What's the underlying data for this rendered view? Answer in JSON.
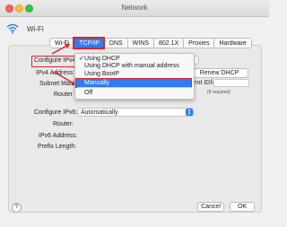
{
  "window": {
    "title": "Network"
  },
  "header": {
    "interface_label": "Wi-Fi"
  },
  "tabs": [
    {
      "label": "Wi-Fi"
    },
    {
      "label": "TCP/IP"
    },
    {
      "label": "DNS"
    },
    {
      "label": "WINS"
    },
    {
      "label": "802.1X"
    },
    {
      "label": "Proxies"
    },
    {
      "label": "Hardware"
    }
  ],
  "active_tab": "TCP/IP",
  "ipv4": {
    "configure_label": "Configure IPv4",
    "address_label": "IPv4 Address",
    "subnet_label": "Subnet Mask",
    "router_label": "Router",
    "renew_button": "Renew DHCP Lease",
    "client_id_label": "ient ID:",
    "if_required": "(If required)"
  },
  "ipv4_menu": {
    "items": [
      {
        "label": "Using DHCP",
        "checked": true
      },
      {
        "label": "Using DHCP with manual address",
        "checked": false
      },
      {
        "label": "Using BootP",
        "checked": false
      },
      {
        "label": "Manually",
        "checked": false
      },
      {
        "label": "Off",
        "checked": false
      }
    ],
    "highlighted": "Manually"
  },
  "ipv6": {
    "configure_label": "Configure IPv6:",
    "configure_value": "Automatically",
    "router_label": "Router:",
    "address_label": "IPv6 Address:",
    "prefix_label": "Prefix Length:"
  },
  "footer": {
    "help": "?",
    "cancel": "Cancel",
    "ok": "OK"
  },
  "colors": {
    "accent": "#2e7cf6",
    "annotation": "#e0202a"
  }
}
